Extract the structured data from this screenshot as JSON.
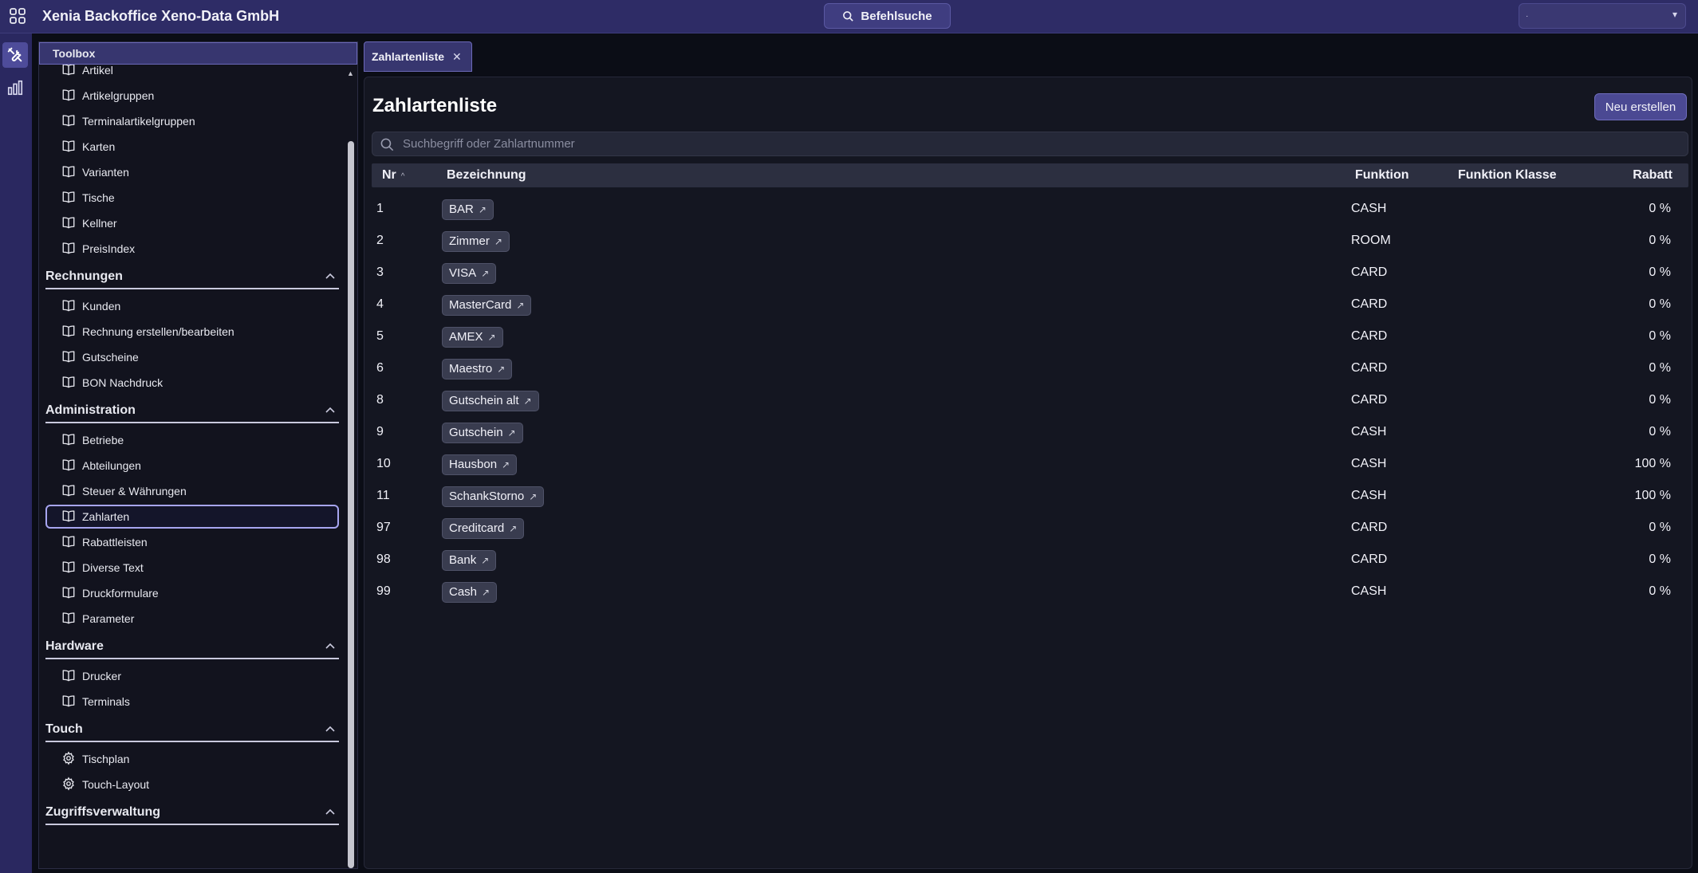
{
  "app": {
    "title": "Xenia Backoffice Xeno-Data GmbH",
    "command_search_label": "Befehlsuche",
    "top_select_value": "·"
  },
  "toolbox": {
    "title": "Toolbox",
    "top_items": [
      "Artikel",
      "Artikelgruppen",
      "Terminalartikelgruppen",
      "Karten",
      "Varianten",
      "Tische",
      "Kellner",
      "PreisIndex"
    ],
    "sections": {
      "rechnungen": {
        "title": "Rechnungen",
        "items": [
          "Kunden",
          "Rechnung erstellen/bearbeiten",
          "Gutscheine",
          "BON Nachdruck"
        ]
      },
      "administration": {
        "title": "Administration",
        "items": [
          "Betriebe",
          "Abteilungen",
          "Steuer & Währungen",
          "Zahlarten",
          "Rabattleisten",
          "Diverse Text",
          "Druckformulare",
          "Parameter"
        ],
        "selected": "Zahlarten"
      },
      "hardware": {
        "title": "Hardware",
        "items": [
          "Drucker",
          "Terminals"
        ]
      },
      "touch": {
        "title": "Touch",
        "items": [
          "Tischplan",
          "Touch-Layout"
        ]
      },
      "zugriff": {
        "title": "Zugriffsverwaltung"
      }
    }
  },
  "tabs": [
    {
      "label": "Zahlartenliste",
      "active": true
    }
  ],
  "main": {
    "title": "Zahlartenliste",
    "new_button": "Neu erstellen",
    "search_placeholder": "Suchbegriff oder Zahlartnummer",
    "columns": {
      "nr": "Nr",
      "bezeichnung": "Bezeichnung",
      "funktion": "Funktion",
      "funktion_klasse": "Funktion Klasse",
      "rabatt": "Rabatt"
    },
    "rows": [
      {
        "nr": "1",
        "bezeichnung": "BAR",
        "funktion": "CASH",
        "funktion_klasse": "",
        "rabatt": "0 %"
      },
      {
        "nr": "2",
        "bezeichnung": "Zimmer",
        "funktion": "ROOM",
        "funktion_klasse": "",
        "rabatt": "0 %"
      },
      {
        "nr": "3",
        "bezeichnung": "VISA",
        "funktion": "CARD",
        "funktion_klasse": "",
        "rabatt": "0 %"
      },
      {
        "nr": "4",
        "bezeichnung": "MasterCard",
        "funktion": "CARD",
        "funktion_klasse": "",
        "rabatt": "0 %"
      },
      {
        "nr": "5",
        "bezeichnung": "AMEX",
        "funktion": "CARD",
        "funktion_klasse": "",
        "rabatt": "0 %"
      },
      {
        "nr": "6",
        "bezeichnung": "Maestro",
        "funktion": "CARD",
        "funktion_klasse": "",
        "rabatt": "0 %"
      },
      {
        "nr": "8",
        "bezeichnung": "Gutschein alt",
        "funktion": "CARD",
        "funktion_klasse": "",
        "rabatt": "0 %"
      },
      {
        "nr": "9",
        "bezeichnung": "Gutschein",
        "funktion": "CASH",
        "funktion_klasse": "",
        "rabatt": "0 %"
      },
      {
        "nr": "10",
        "bezeichnung": "Hausbon",
        "funktion": "CASH",
        "funktion_klasse": "",
        "rabatt": "100 %"
      },
      {
        "nr": "11",
        "bezeichnung": "SchankStorno",
        "funktion": "CASH",
        "funktion_klasse": "",
        "rabatt": "100 %"
      },
      {
        "nr": "97",
        "bezeichnung": "Creditcard",
        "funktion": "CARD",
        "funktion_klasse": "",
        "rabatt": "0 %"
      },
      {
        "nr": "98",
        "bezeichnung": "Bank",
        "funktion": "CARD",
        "funktion_klasse": "",
        "rabatt": "0 %"
      },
      {
        "nr": "99",
        "bezeichnung": "Cash",
        "funktion": "CASH",
        "funktion_klasse": "",
        "rabatt": "0 %"
      }
    ]
  },
  "icons": {
    "apps": "apps-grid-icon",
    "search": "search-icon",
    "toolbox": "tools-icon",
    "stats": "bar-chart-icon",
    "book": "book-icon",
    "gear": "gear-icon",
    "external": "external-link-icon"
  },
  "colors": {
    "topbar": "#2e2c66",
    "accent": "#4b4993",
    "background": "#0b0d16",
    "panel": "#141621"
  }
}
